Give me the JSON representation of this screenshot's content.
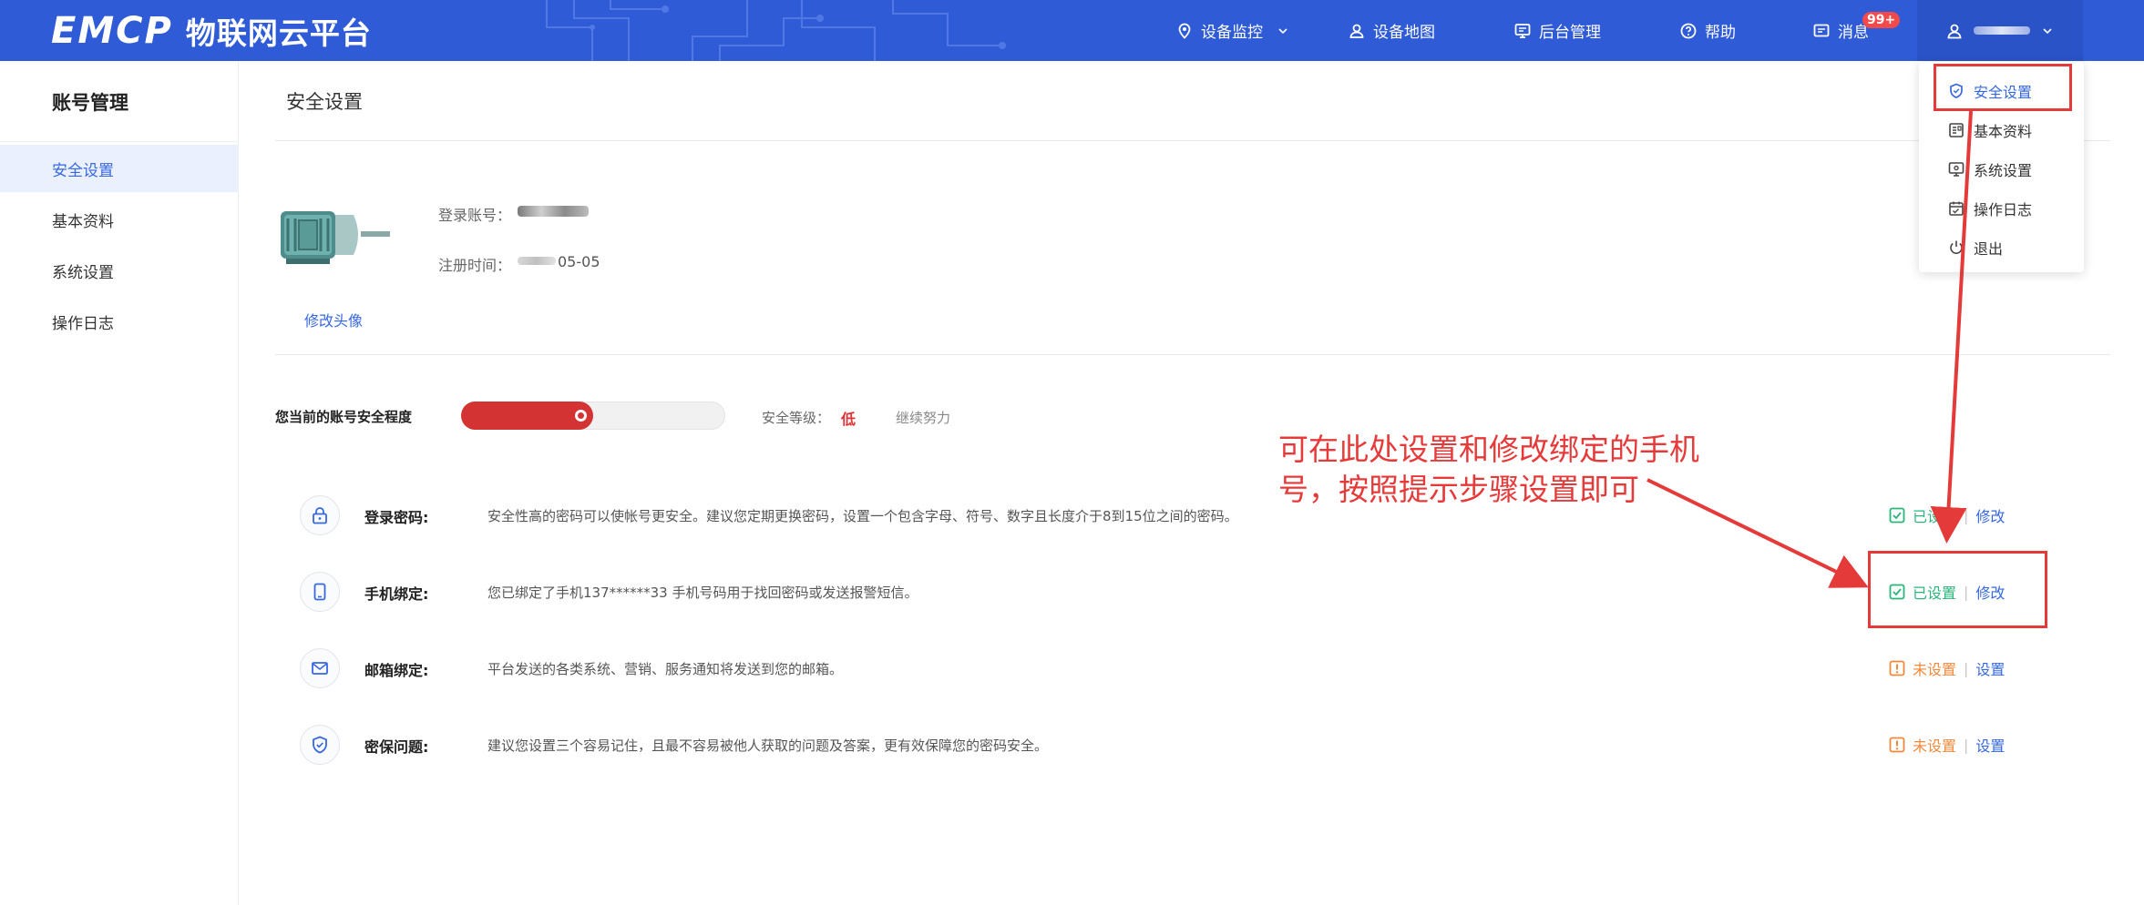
{
  "header": {
    "logo_text": "EMCP",
    "platform_name": "物联网云平台",
    "nav": [
      {
        "label": "设备监控",
        "icon": "location-pin-icon"
      },
      {
        "label": "设备地图",
        "icon": "person-map-icon"
      },
      {
        "label": "后台管理",
        "icon": "monitor-icon"
      },
      {
        "label": "帮助",
        "icon": "help-circle-icon"
      },
      {
        "label": "消息",
        "icon": "message-icon"
      }
    ],
    "message_badge": "99+",
    "user_icon": "user-icon"
  },
  "user_menu": {
    "items": [
      {
        "label": "安全设置",
        "icon": "shield-icon"
      },
      {
        "label": "基本资料",
        "icon": "profile-card-icon"
      },
      {
        "label": "系统设置",
        "icon": "settings-screen-icon"
      },
      {
        "label": "操作日志",
        "icon": "calendar-log-icon"
      },
      {
        "label": "退出",
        "icon": "power-icon"
      }
    ]
  },
  "sidebar": {
    "title": "账号管理",
    "items": [
      {
        "label": "安全设置"
      },
      {
        "label": "基本资料"
      },
      {
        "label": "系统设置"
      },
      {
        "label": "操作日志"
      }
    ]
  },
  "main": {
    "title": "安全设置",
    "profile": {
      "change_avatar": "修改头像",
      "account_label": "登录账号：",
      "register_label": "注册时间：",
      "register_date_suffix": "05-05"
    },
    "security": {
      "label": "您当前的账号安全程度",
      "score_percent": 50,
      "level_label": "安全等级：",
      "level": "低",
      "hint": "继续努力"
    },
    "rows": [
      {
        "icon": "lock-icon",
        "title": "登录密码:",
        "desc": "安全性高的密码可以使帐号更安全。建议您定期更换密码，设置一个包含字母、符号、数字且长度介于8到15位之间的密码。",
        "status": "已设置",
        "status_type": "ok",
        "action": "修改"
      },
      {
        "icon": "phone-icon",
        "title": "手机绑定:",
        "desc": "您已绑定了手机137******33 手机号码用于找回密码或发送报警短信。",
        "status": "已设置",
        "status_type": "ok",
        "action": "修改"
      },
      {
        "icon": "mail-icon",
        "title": "邮箱绑定:",
        "desc": "平台发送的各类系统、营销、服务通知将发送到您的邮箱。",
        "status": "未设置",
        "status_type": "warn",
        "action": "设置"
      },
      {
        "icon": "shield-check-icon",
        "title": "密保问题:",
        "desc": "建议您设置三个容易记住，且最不容易被他人获取的问题及答案，更有效保障您的密码安全。",
        "status": "未设置",
        "status_type": "warn",
        "action": "设置"
      }
    ]
  },
  "annotation": {
    "text": "可在此处设置和修改绑定的手机号，按照提示步骤设置即可"
  },
  "colors": {
    "header_bg": "#2f5bd6",
    "accent": "#3768e0",
    "danger": "#d43333",
    "ok": "#2bb57a",
    "warn": "#f08a3e",
    "annotation": "#e53a3a"
  }
}
